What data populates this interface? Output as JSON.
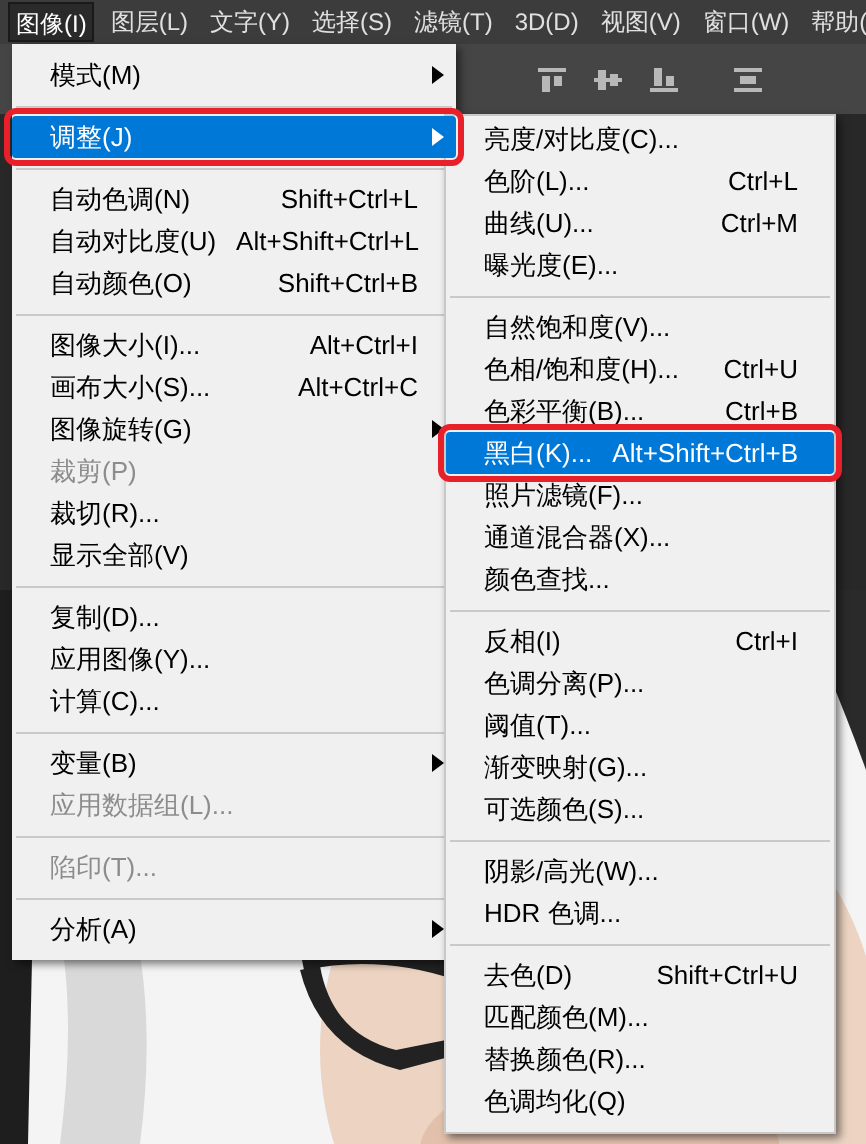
{
  "menu_bar": [
    {
      "label": "图像(I)",
      "selected": true
    },
    {
      "label": "图层(L)",
      "selected": false
    },
    {
      "label": "文字(Y)",
      "selected": false
    },
    {
      "label": "选择(S)",
      "selected": false
    },
    {
      "label": "滤镜(T)",
      "selected": false
    },
    {
      "label": "3D(D)",
      "selected": false
    },
    {
      "label": "视图(V)",
      "selected": false
    },
    {
      "label": "窗口(W)",
      "selected": false
    },
    {
      "label": "帮助(",
      "selected": false
    }
  ],
  "main_menu": {
    "groups": [
      [
        {
          "label": "模式(M)",
          "submenu": true,
          "disabled": false,
          "selected": false,
          "framed": false
        }
      ],
      [
        {
          "label": "调整(J)",
          "submenu": true,
          "disabled": false,
          "selected": true,
          "framed": true
        }
      ],
      [
        {
          "label": "自动色调(N)",
          "shortcut": "Shift+Ctrl+L",
          "submenu": false,
          "disabled": false,
          "selected": false,
          "framed": false
        },
        {
          "label": "自动对比度(U)",
          "shortcut": "Alt+Shift+Ctrl+L",
          "submenu": false,
          "disabled": false,
          "selected": false,
          "framed": false
        },
        {
          "label": "自动颜色(O)",
          "shortcut": "Shift+Ctrl+B",
          "submenu": false,
          "disabled": false,
          "selected": false,
          "framed": false
        }
      ],
      [
        {
          "label": "图像大小(I)...",
          "shortcut": "Alt+Ctrl+I",
          "submenu": false,
          "disabled": false,
          "selected": false,
          "framed": false
        },
        {
          "label": "画布大小(S)...",
          "shortcut": "Alt+Ctrl+C",
          "submenu": false,
          "disabled": false,
          "selected": false,
          "framed": false
        },
        {
          "label": "图像旋转(G)",
          "submenu": true,
          "disabled": false,
          "selected": false,
          "framed": false
        },
        {
          "label": "裁剪(P)",
          "submenu": false,
          "disabled": true,
          "selected": false,
          "framed": false
        },
        {
          "label": "裁切(R)...",
          "submenu": false,
          "disabled": false,
          "selected": false,
          "framed": false
        },
        {
          "label": "显示全部(V)",
          "submenu": false,
          "disabled": false,
          "selected": false,
          "framed": false
        }
      ],
      [
        {
          "label": "复制(D)...",
          "submenu": false,
          "disabled": false,
          "selected": false,
          "framed": false
        },
        {
          "label": "应用图像(Y)...",
          "submenu": false,
          "disabled": false,
          "selected": false,
          "framed": false
        },
        {
          "label": "计算(C)...",
          "submenu": false,
          "disabled": false,
          "selected": false,
          "framed": false
        }
      ],
      [
        {
          "label": "变量(B)",
          "submenu": true,
          "disabled": false,
          "selected": false,
          "framed": false
        },
        {
          "label": "应用数据组(L)...",
          "submenu": false,
          "disabled": true,
          "selected": false,
          "framed": false
        }
      ],
      [
        {
          "label": "陷印(T)...",
          "submenu": false,
          "disabled": true,
          "selected": false,
          "framed": false
        }
      ],
      [
        {
          "label": "分析(A)",
          "submenu": true,
          "disabled": false,
          "selected": false,
          "framed": false
        }
      ]
    ]
  },
  "submenu": {
    "groups": [
      [
        {
          "label": "亮度/对比度(C)...",
          "selected": false,
          "framed": false
        },
        {
          "label": "色阶(L)...",
          "shortcut": "Ctrl+L",
          "selected": false,
          "framed": false
        },
        {
          "label": "曲线(U)...",
          "shortcut": "Ctrl+M",
          "selected": false,
          "framed": false
        },
        {
          "label": "曝光度(E)...",
          "selected": false,
          "framed": false
        }
      ],
      [
        {
          "label": "自然饱和度(V)...",
          "selected": false,
          "framed": false
        },
        {
          "label": "色相/饱和度(H)...",
          "shortcut": "Ctrl+U",
          "selected": false,
          "framed": false
        },
        {
          "label": "色彩平衡(B)...",
          "shortcut": "Ctrl+B",
          "selected": false,
          "framed": false
        },
        {
          "label": "黑白(K)...",
          "shortcut": "Alt+Shift+Ctrl+B",
          "selected": true,
          "framed": true
        },
        {
          "label": "照片滤镜(F)...",
          "selected": false,
          "framed": false
        },
        {
          "label": "通道混合器(X)...",
          "selected": false,
          "framed": false
        },
        {
          "label": "颜色查找...",
          "selected": false,
          "framed": false
        }
      ],
      [
        {
          "label": "反相(I)",
          "shortcut": "Ctrl+I",
          "selected": false,
          "framed": false
        },
        {
          "label": "色调分离(P)...",
          "selected": false,
          "framed": false
        },
        {
          "label": "阈值(T)...",
          "selected": false,
          "framed": false
        },
        {
          "label": "渐变映射(G)...",
          "selected": false,
          "framed": false
        },
        {
          "label": "可选颜色(S)...",
          "selected": false,
          "framed": false
        }
      ],
      [
        {
          "label": "阴影/高光(W)...",
          "selected": false,
          "framed": false
        },
        {
          "label": "HDR 色调...",
          "selected": false,
          "framed": false
        }
      ],
      [
        {
          "label": "去色(D)",
          "shortcut": "Shift+Ctrl+U",
          "selected": false,
          "framed": false
        },
        {
          "label": "匹配颜色(M)...",
          "selected": false,
          "framed": false
        },
        {
          "label": "替换颜色(R)...",
          "selected": false,
          "framed": false
        },
        {
          "label": "色调均化(Q)",
          "selected": false,
          "framed": false
        }
      ]
    ]
  }
}
